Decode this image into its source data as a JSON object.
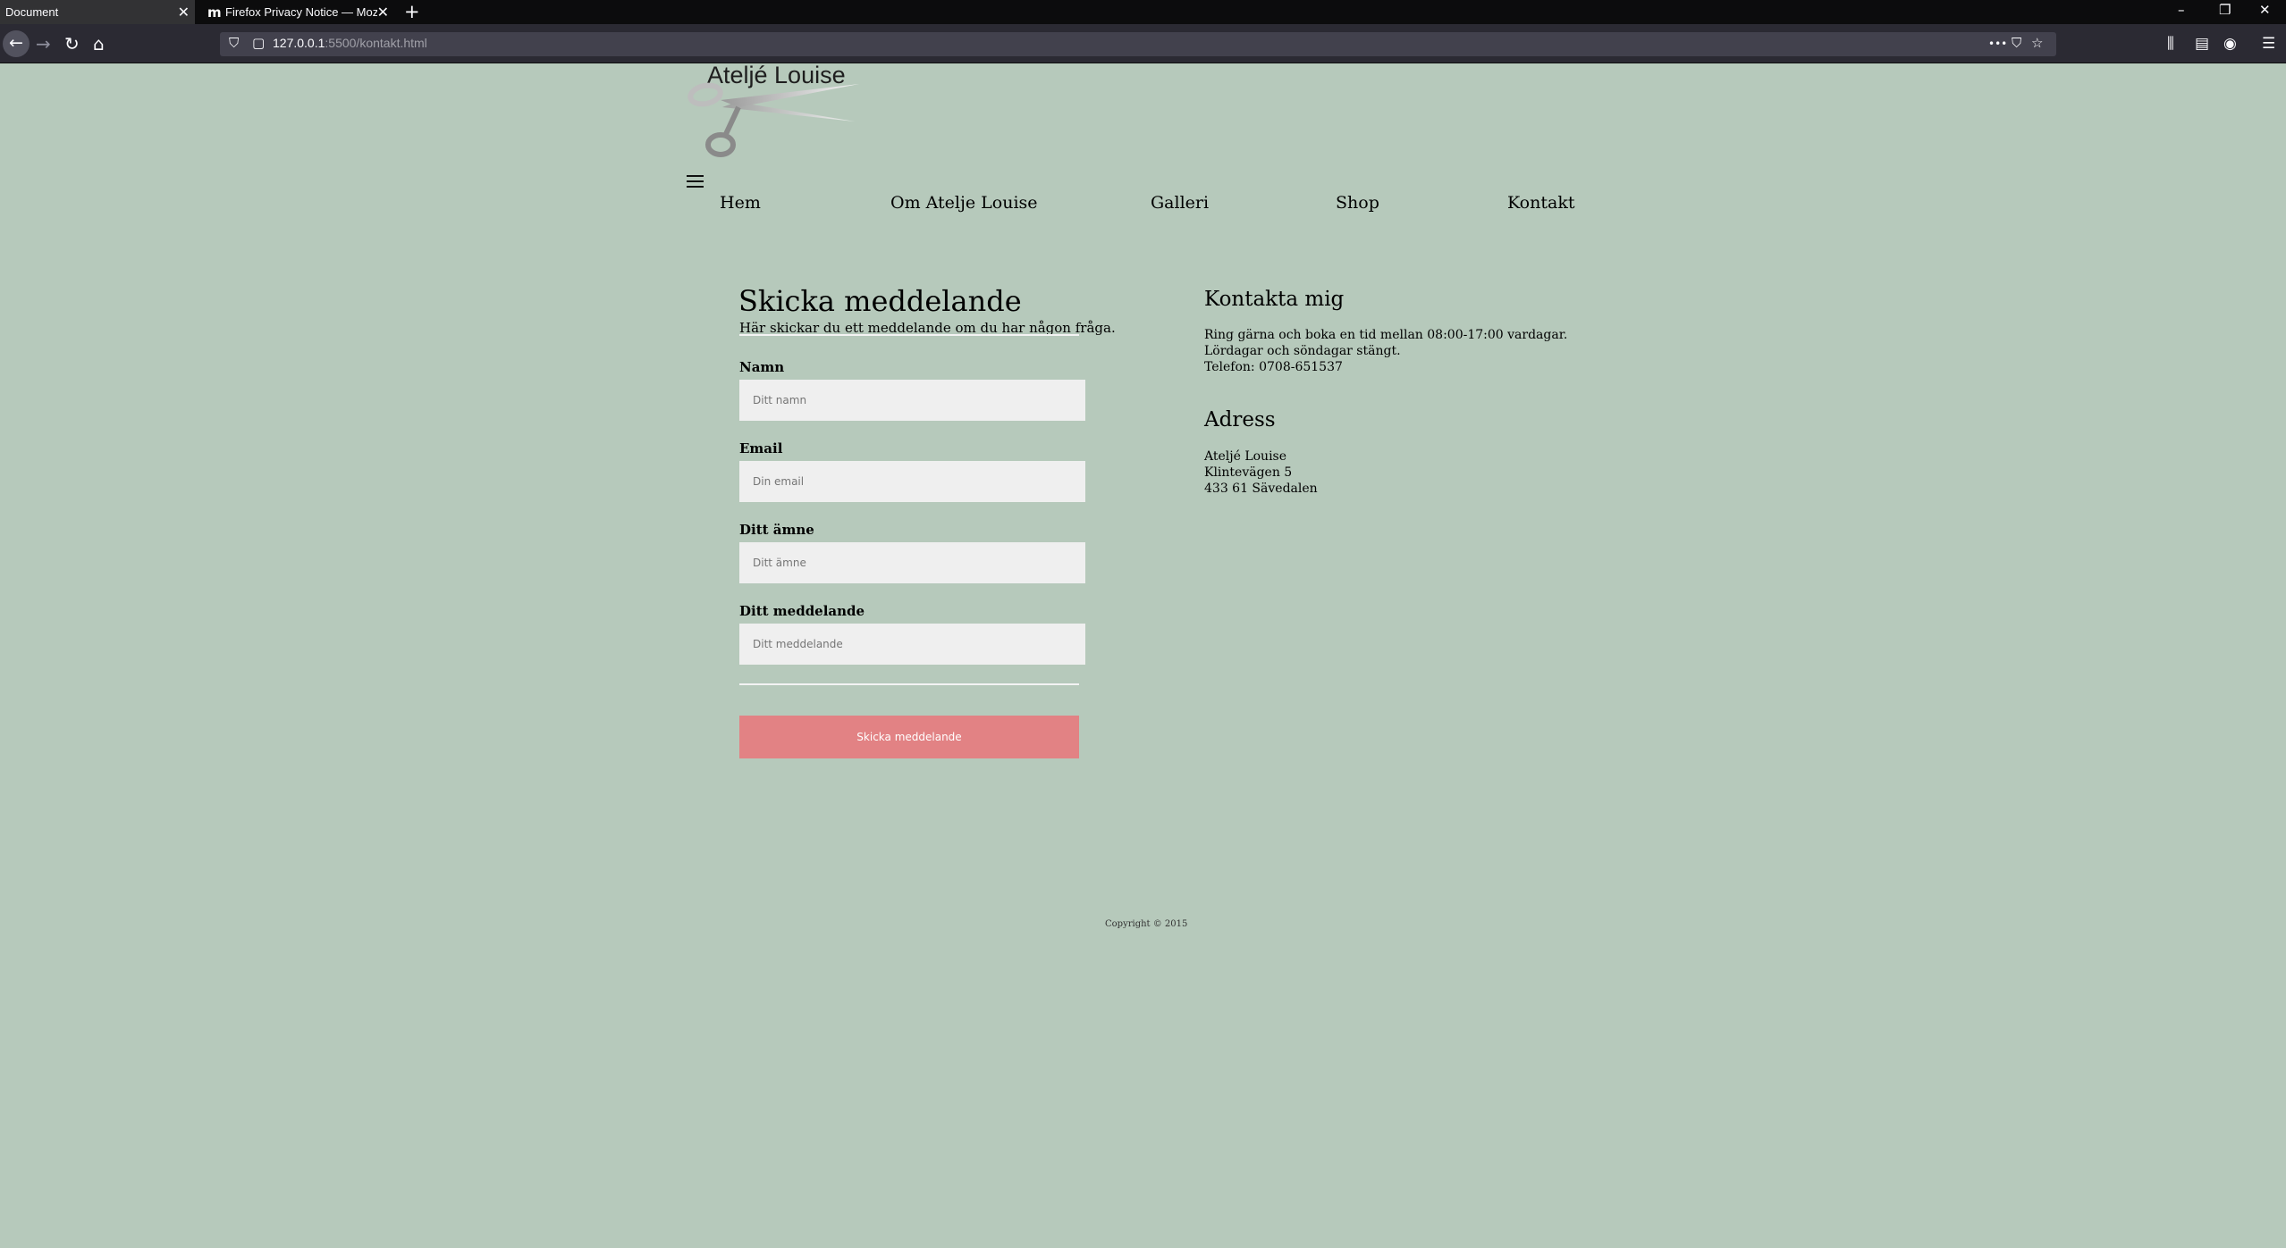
{
  "browser": {
    "tabs": [
      {
        "title": "Document",
        "active": true
      },
      {
        "title": "Firefox Privacy Notice — Mozilla",
        "active": false,
        "favicon": "m"
      }
    ],
    "url": {
      "host": "127.0.0.1",
      "path": ":5500/kontakt.html"
    },
    "icons": {
      "close": "✕",
      "new_tab": "+",
      "minimize": "–",
      "restore": "❐",
      "window_close": "✕",
      "back": "←",
      "forward": "→",
      "reload": "↻",
      "home": "⌂",
      "shield": "⛉",
      "page": "▢",
      "more": "•••",
      "pocket": "⛉",
      "star": "☆",
      "library": "⫼",
      "sidebar": "▤",
      "account": "◉",
      "menu": "☰"
    }
  },
  "site": {
    "logo_text": "Ateljé Louise",
    "nav": [
      "Hem",
      "Om Atelje Louise",
      "Galleri",
      "Shop",
      "Kontakt"
    ]
  },
  "form": {
    "title": "Skicka meddelande",
    "subtitle": "Här skickar du ett meddelande om du har någon fråga.",
    "fields": [
      {
        "label": "Namn",
        "placeholder": "Ditt namn"
      },
      {
        "label": "Email",
        "placeholder": "Din email"
      },
      {
        "label": "Ditt ämne",
        "placeholder": "Ditt ämne"
      },
      {
        "label": "Ditt meddelande",
        "placeholder": "Ditt meddelande"
      }
    ],
    "submit_label": "Skicka meddelande"
  },
  "contact": {
    "heading": "Kontakta mig",
    "lines": [
      "Ring gärna och boka en tid mellan 08:00-17:00 vardagar.",
      "Lördagar och söndagar stängt.",
      "Telefon: 0708-651537"
    ]
  },
  "address": {
    "heading": "Adress",
    "lines": [
      "Ateljé Louise",
      "Klintevägen 5",
      "433 61 Sävedalen"
    ]
  },
  "footer": {
    "copyright": "Copyright © 2015"
  }
}
